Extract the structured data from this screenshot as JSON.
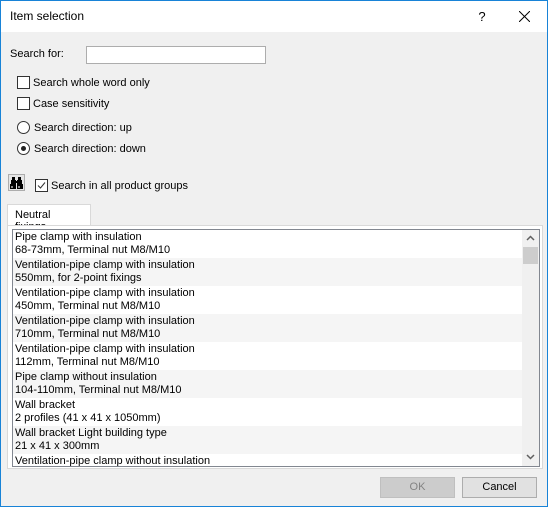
{
  "window": {
    "title": "Item selection",
    "help_label": "?"
  },
  "search": {
    "label": "Search for:",
    "value": "",
    "whole_word_label": "Search whole word only",
    "whole_word_checked": false,
    "case_label": "Case sensitivity",
    "case_checked": false,
    "dir_up_label": "Search direction: up",
    "dir_down_label": "Search direction: down",
    "direction": "down",
    "all_groups_label": "Search in all product groups",
    "all_groups_checked": true
  },
  "tabs": [
    {
      "label": "Neutral fixings",
      "active": true
    }
  ],
  "items": [
    {
      "line1": "Pipe clamp with insulation",
      "line2": "68-73mm, Terminal nut M8/M10"
    },
    {
      "line1": "Ventilation-pipe clamp with insulation",
      "line2": "550mm, for 2-point fixings"
    },
    {
      "line1": "Ventilation-pipe clamp with insulation",
      "line2": "450mm, Terminal nut M8/M10"
    },
    {
      "line1": "Ventilation-pipe clamp with insulation",
      "line2": "710mm, Terminal nut M8/M10"
    },
    {
      "line1": "Ventilation-pipe clamp with insulation",
      "line2": "112mm, Terminal nut M8/M10"
    },
    {
      "line1": "Pipe clamp without insulation",
      "line2": "104-110mm, Terminal nut M8/M10"
    },
    {
      "line1": "Wall bracket",
      "line2": "2 profiles (41 x 41 x 1050mm)"
    },
    {
      "line1": "Wall bracket Light building type",
      "line2": "21 x 41 x 300mm"
    },
    {
      "line1": "Ventilation-pipe clamp without insulation",
      "line2": ""
    }
  ],
  "buttons": {
    "ok": "OK",
    "ok_enabled": false,
    "cancel": "Cancel"
  },
  "colors": {
    "window_border": "#1883d7",
    "dialog_bg": "#f0f0f0"
  }
}
